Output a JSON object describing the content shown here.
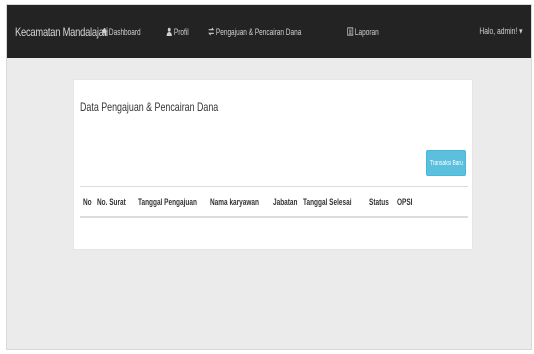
{
  "navbar": {
    "brand": "Kecamatan Mandalajati",
    "items": [
      {
        "label": "Dashboard",
        "icon": "home-icon"
      },
      {
        "label": "Profil",
        "icon": "user-icon"
      },
      {
        "label": "Pengajuan & Pencairan Dana",
        "icon": "exchange-icon"
      },
      {
        "label": "Laporan",
        "icon": "list-icon"
      }
    ],
    "user_menu": "Halo, admin! ▾"
  },
  "panel": {
    "title": "Data Pengajuan & Pencairan Dana",
    "button_label": "Transaksi Baru"
  },
  "table": {
    "headers": [
      "No",
      "No. Surat",
      "Tanggal Pengajuan",
      "Nama karyawan",
      "Jabatan",
      "Tanggal Selesai",
      "Status",
      "OPSI"
    ]
  },
  "colors": {
    "navbar_bg": "#232323",
    "button_bg": "#5bc0de",
    "page_bg": "#ebebeb"
  }
}
